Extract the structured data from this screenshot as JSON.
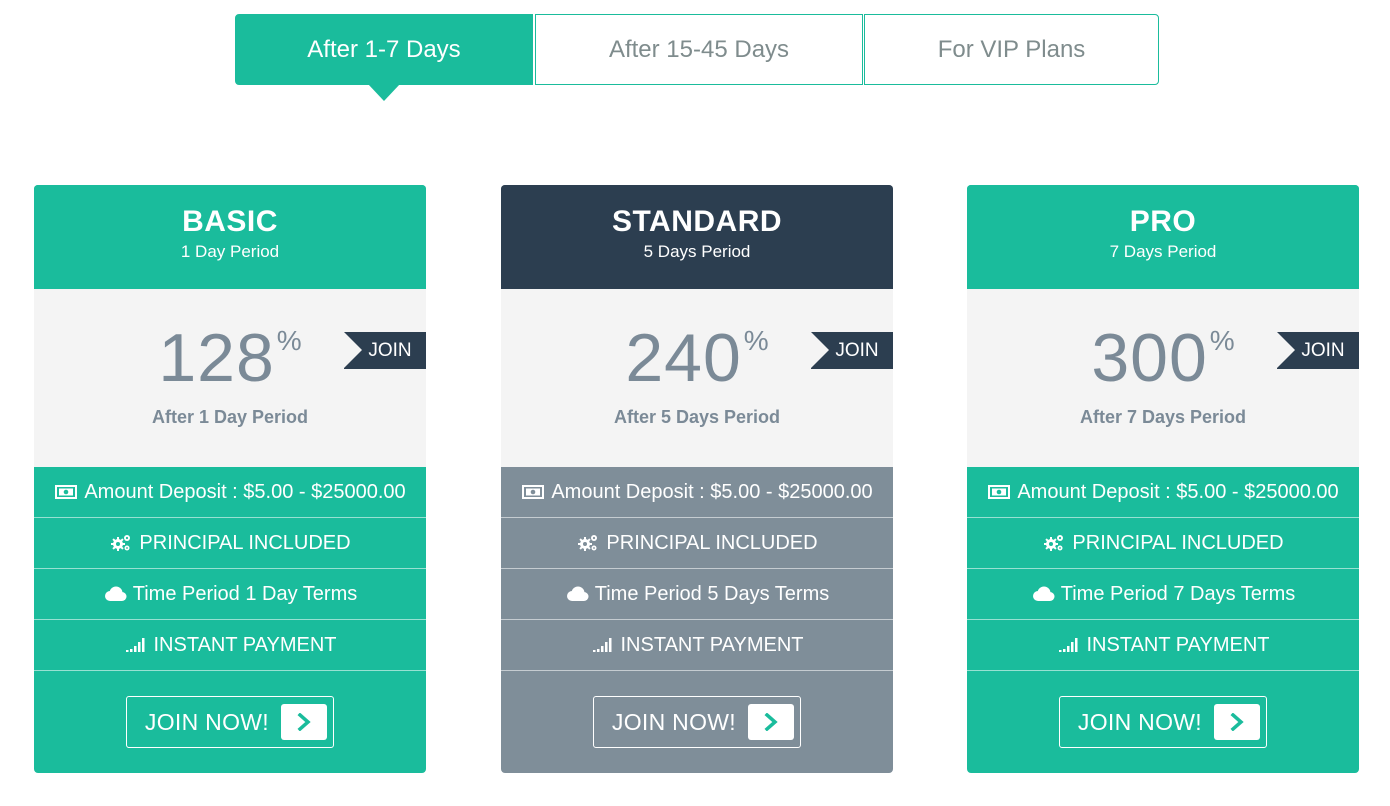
{
  "tabs": [
    {
      "label": "After 1-7 Days",
      "active": true
    },
    {
      "label": "After 15-45 Days",
      "active": false
    },
    {
      "label": "For VIP Plans",
      "active": false
    }
  ],
  "colors": {
    "accent": "#1abc9c",
    "dark": "#2c3e50",
    "muted": "#7f8e99",
    "price_bg": "#f4f4f4",
    "price_text": "#7b8a97"
  },
  "plans": [
    {
      "name": "BASIC",
      "period": "1 Day Period",
      "rate": "128",
      "rate_unit": "%",
      "rate_caption": "After 1 Day Period",
      "ribbon": "JOIN",
      "features": [
        {
          "icon": "money-icon",
          "text": "Amount Deposit : $5.00 - $25000.00"
        },
        {
          "icon": "gears-icon",
          "text": "PRINCIPAL INCLUDED"
        },
        {
          "icon": "cloud-icon",
          "text": "Time Period 1 Day Terms"
        },
        {
          "icon": "signal-icon",
          "text": "INSTANT PAYMENT"
        }
      ],
      "button": "JOIN NOW!",
      "button_icon": "chevron-right-icon"
    },
    {
      "name": "STANDARD",
      "period": "5 Days Period",
      "rate": "240",
      "rate_unit": "%",
      "rate_caption": "After 5 Days Period",
      "ribbon": "JOIN",
      "features": [
        {
          "icon": "money-icon",
          "text": "Amount Deposit : $5.00 - $25000.00"
        },
        {
          "icon": "gears-icon",
          "text": "PRINCIPAL INCLUDED"
        },
        {
          "icon": "cloud-icon",
          "text": "Time Period 5 Days Terms"
        },
        {
          "icon": "signal-icon",
          "text": "INSTANT PAYMENT"
        }
      ],
      "button": "JOIN NOW!",
      "button_icon": "chevron-right-icon"
    },
    {
      "name": "PRO",
      "period": "7 Days Period",
      "rate": "300",
      "rate_unit": "%",
      "rate_caption": "After 7 Days Period",
      "ribbon": "JOIN",
      "features": [
        {
          "icon": "money-icon",
          "text": "Amount Deposit : $5.00 - $25000.00"
        },
        {
          "icon": "gears-icon",
          "text": "PRINCIPAL INCLUDED"
        },
        {
          "icon": "cloud-icon",
          "text": "Time Period 7 Days Terms"
        },
        {
          "icon": "signal-icon",
          "text": "INSTANT PAYMENT"
        }
      ],
      "button": "JOIN NOW!",
      "button_icon": "chevron-right-icon"
    }
  ]
}
